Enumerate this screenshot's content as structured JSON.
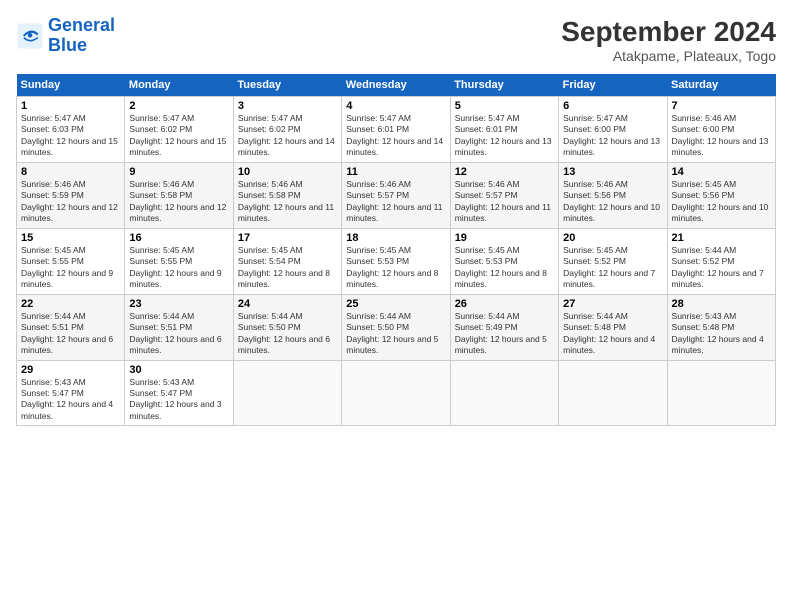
{
  "logo": {
    "line1": "General",
    "line2": "Blue"
  },
  "title": "September 2024",
  "subtitle": "Atakpame, Plateaux, Togo",
  "days_header": [
    "Sunday",
    "Monday",
    "Tuesday",
    "Wednesday",
    "Thursday",
    "Friday",
    "Saturday"
  ],
  "weeks": [
    [
      {
        "num": "1",
        "rise": "5:47 AM",
        "set": "6:03 PM",
        "daylight": "12 hours and 15 minutes."
      },
      {
        "num": "2",
        "rise": "5:47 AM",
        "set": "6:02 PM",
        "daylight": "12 hours and 15 minutes."
      },
      {
        "num": "3",
        "rise": "5:47 AM",
        "set": "6:02 PM",
        "daylight": "12 hours and 14 minutes."
      },
      {
        "num": "4",
        "rise": "5:47 AM",
        "set": "6:01 PM",
        "daylight": "12 hours and 14 minutes."
      },
      {
        "num": "5",
        "rise": "5:47 AM",
        "set": "6:01 PM",
        "daylight": "12 hours and 13 minutes."
      },
      {
        "num": "6",
        "rise": "5:47 AM",
        "set": "6:00 PM",
        "daylight": "12 hours and 13 minutes."
      },
      {
        "num": "7",
        "rise": "5:46 AM",
        "set": "6:00 PM",
        "daylight": "12 hours and 13 minutes."
      }
    ],
    [
      {
        "num": "8",
        "rise": "5:46 AM",
        "set": "5:59 PM",
        "daylight": "12 hours and 12 minutes."
      },
      {
        "num": "9",
        "rise": "5:46 AM",
        "set": "5:58 PM",
        "daylight": "12 hours and 12 minutes."
      },
      {
        "num": "10",
        "rise": "5:46 AM",
        "set": "5:58 PM",
        "daylight": "12 hours and 11 minutes."
      },
      {
        "num": "11",
        "rise": "5:46 AM",
        "set": "5:57 PM",
        "daylight": "12 hours and 11 minutes."
      },
      {
        "num": "12",
        "rise": "5:46 AM",
        "set": "5:57 PM",
        "daylight": "12 hours and 11 minutes."
      },
      {
        "num": "13",
        "rise": "5:46 AM",
        "set": "5:56 PM",
        "daylight": "12 hours and 10 minutes."
      },
      {
        "num": "14",
        "rise": "5:45 AM",
        "set": "5:56 PM",
        "daylight": "12 hours and 10 minutes."
      }
    ],
    [
      {
        "num": "15",
        "rise": "5:45 AM",
        "set": "5:55 PM",
        "daylight": "12 hours and 9 minutes."
      },
      {
        "num": "16",
        "rise": "5:45 AM",
        "set": "5:55 PM",
        "daylight": "12 hours and 9 minutes."
      },
      {
        "num": "17",
        "rise": "5:45 AM",
        "set": "5:54 PM",
        "daylight": "12 hours and 8 minutes."
      },
      {
        "num": "18",
        "rise": "5:45 AM",
        "set": "5:53 PM",
        "daylight": "12 hours and 8 minutes."
      },
      {
        "num": "19",
        "rise": "5:45 AM",
        "set": "5:53 PM",
        "daylight": "12 hours and 8 minutes."
      },
      {
        "num": "20",
        "rise": "5:45 AM",
        "set": "5:52 PM",
        "daylight": "12 hours and 7 minutes."
      },
      {
        "num": "21",
        "rise": "5:44 AM",
        "set": "5:52 PM",
        "daylight": "12 hours and 7 minutes."
      }
    ],
    [
      {
        "num": "22",
        "rise": "5:44 AM",
        "set": "5:51 PM",
        "daylight": "12 hours and 6 minutes."
      },
      {
        "num": "23",
        "rise": "5:44 AM",
        "set": "5:51 PM",
        "daylight": "12 hours and 6 minutes."
      },
      {
        "num": "24",
        "rise": "5:44 AM",
        "set": "5:50 PM",
        "daylight": "12 hours and 6 minutes."
      },
      {
        "num": "25",
        "rise": "5:44 AM",
        "set": "5:50 PM",
        "daylight": "12 hours and 5 minutes."
      },
      {
        "num": "26",
        "rise": "5:44 AM",
        "set": "5:49 PM",
        "daylight": "12 hours and 5 minutes."
      },
      {
        "num": "27",
        "rise": "5:44 AM",
        "set": "5:48 PM",
        "daylight": "12 hours and 4 minutes."
      },
      {
        "num": "28",
        "rise": "5:43 AM",
        "set": "5:48 PM",
        "daylight": "12 hours and 4 minutes."
      }
    ],
    [
      {
        "num": "29",
        "rise": "5:43 AM",
        "set": "5:47 PM",
        "daylight": "12 hours and 4 minutes."
      },
      {
        "num": "30",
        "rise": "5:43 AM",
        "set": "5:47 PM",
        "daylight": "12 hours and 3 minutes."
      },
      null,
      null,
      null,
      null,
      null
    ]
  ]
}
